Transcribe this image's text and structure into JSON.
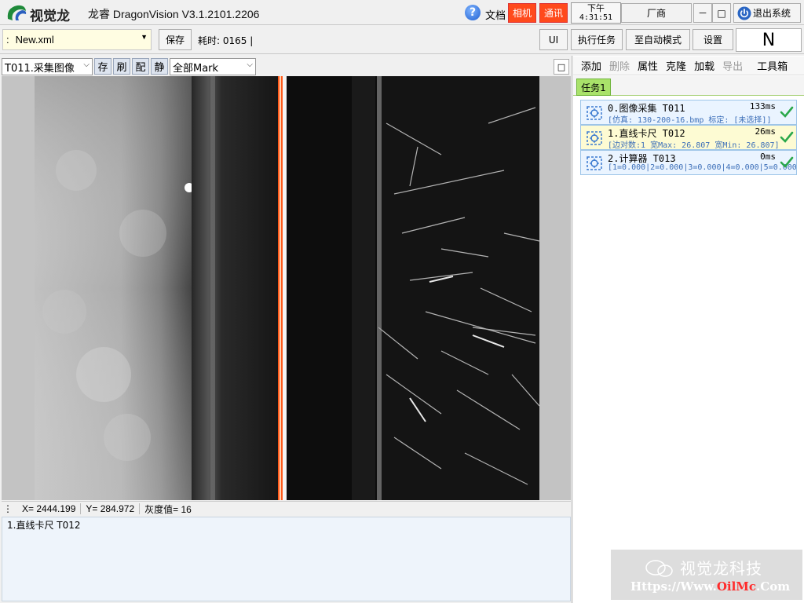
{
  "titlebar": {
    "logo_text": "视觉龙",
    "app_title": "龙睿 DragonVision V3.1.2101.2206",
    "help_glyph": "?",
    "doc_label": "文档",
    "camera_label": "相机",
    "comm_label": "通讯",
    "clock_period": "下午",
    "clock_time": "4:31:51",
    "vendor_label": "厂商",
    "minimize_glyph": "－",
    "maximize_glyph": "□",
    "exit_label": "退出系统"
  },
  "toolbar": {
    "file_prefix": ":",
    "file_name": "New.xml",
    "save_label": "保存",
    "elapsed_label": "耗时: 0165 |",
    "ui_label": "UI",
    "run_label": "执行任务",
    "auto_label": "至自动模式",
    "settings_label": "设置",
    "mode_letter": "N"
  },
  "image_toolbar": {
    "source_select": "T011.采集图像",
    "btn_save": "存",
    "btn_refresh": "刷",
    "btn_match": "配",
    "btn_still": "静",
    "mark_select": "全部Mark",
    "expand_glyph": "□"
  },
  "statusbar": {
    "x": "X= 2444.199",
    "y": "Y= 284.972",
    "gray": "灰度值= 16"
  },
  "log": {
    "line1": "1.直线卡尺 T012"
  },
  "right_toolbar": {
    "add": "添加",
    "delete": "删除",
    "properties": "属性",
    "clone": "克隆",
    "load": "加载",
    "export": "导出",
    "toolbox": "工具箱"
  },
  "task_tab": "任务1",
  "tools": [
    {
      "name": "0.图像采集  T011",
      "time": "133ms",
      "detail": "[仿真: 130-200-16.bmp  标定: [未选择]]",
      "icon": "camera-tool-icon",
      "status": "ok"
    },
    {
      "name": "1.直线卡尺  T012",
      "time": "26ms",
      "detail": "[边对数:1  宽Max: 26.807  宽Min: 26.807]",
      "icon": "caliper-tool-icon",
      "status": "ok"
    },
    {
      "name": "2.计算器  T013",
      "time": "0ms",
      "detail": "[1=0.000|2=0.000|3=0.000|4=0.000|5=0.000",
      "icon": "calculator-tool-icon",
      "status": "ok"
    }
  ],
  "watermark": {
    "text": "视觉龙科技",
    "url_a": "Https://Www.",
    "url_b": "OilMc",
    "url_c": ".Com"
  },
  "colors": {
    "alert_red": "#ff4a1c",
    "task_green": "#a9e26a",
    "tool_highlight": "#fdfbd3",
    "tool_normal": "#eaf4ff",
    "edge_line": "#ff5a1a"
  }
}
